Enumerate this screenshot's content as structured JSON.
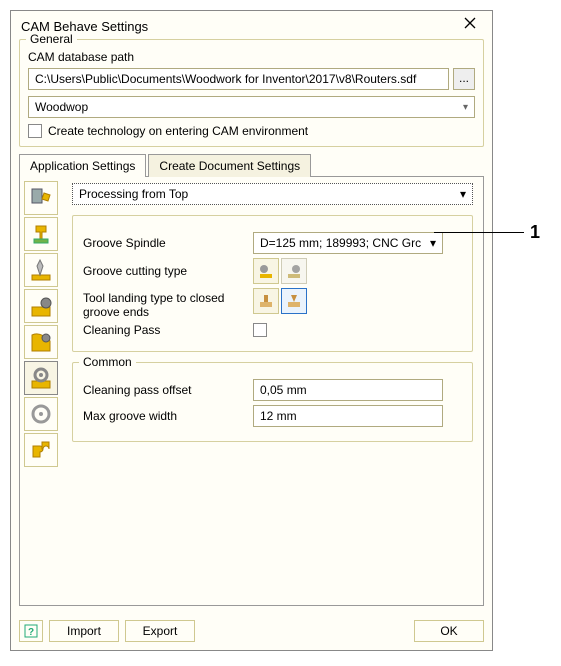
{
  "window": {
    "title": "CAM Behave Settings"
  },
  "general": {
    "legend": "General",
    "db_label": "CAM database path",
    "db_path": "C:\\Users\\Public\\Documents\\Woodwork for Inventor\\2017\\v8\\Routers.sdf",
    "browse": "...",
    "profile": "Woodwop",
    "create_tech": "Create technology on entering CAM environment"
  },
  "tabs": {
    "app": "Application Settings",
    "doc": "Create Document Settings"
  },
  "side_icons": [
    "machine-tool",
    "clamp-tool",
    "drill-tool",
    "cut-tool",
    "shape-tool",
    "gear-tool",
    "gear2-tool",
    "puzzle-tool"
  ],
  "proc": {
    "value": "Processing from Top"
  },
  "groove": {
    "spindle_label": "Groove Spindle",
    "spindle_value": "D=125 mm; 189993; CNC Grc",
    "cutting_label": "Groove cutting type",
    "landing_label": "Tool landing type to closed groove ends",
    "cleaning_label": "Cleaning Pass"
  },
  "common": {
    "legend": "Common",
    "offset_label": "Cleaning pass offset",
    "offset_value": "0,05 mm",
    "maxw_label": "Max groove width",
    "maxw_value": "12 mm"
  },
  "buttons": {
    "import": "Import",
    "export": "Export",
    "ok": "OK"
  },
  "callout": {
    "num": "1"
  }
}
